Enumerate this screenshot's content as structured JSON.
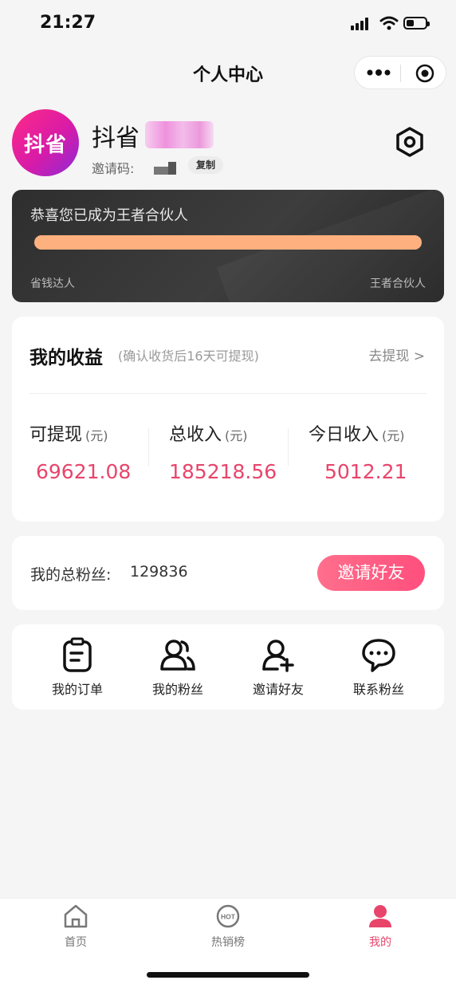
{
  "status_bar": {
    "time": "21:27"
  },
  "nav": {
    "title": "个人中心"
  },
  "profile": {
    "avatar_text": "抖省",
    "name": "抖省",
    "invite_label": "邀请码:",
    "copy_label": "复制"
  },
  "partner_card": {
    "message": "恭喜您已成为王者合伙人",
    "progress": 1.0,
    "level_from": "省钱达人",
    "level_to": "王者合伙人",
    "bar_color": "#ffb07f"
  },
  "income": {
    "title": "我的收益",
    "note": "(确认收货后16天可提现)",
    "withdraw_link": "去提现 >",
    "stats": [
      {
        "label": "可提现",
        "unit": "(元)",
        "value": "69621.08"
      },
      {
        "label": "总收入",
        "unit": "(元)",
        "value": "185218.56"
      },
      {
        "label": "今日收入",
        "unit": "(元)",
        "value": "5012.21"
      }
    ],
    "value_color": "#e8456b"
  },
  "fans": {
    "label": "我的总粉丝:",
    "count": "129836",
    "invite_button": "邀请好友"
  },
  "menu": [
    {
      "label": "我的订单",
      "icon": "order-icon"
    },
    {
      "label": "我的粉丝",
      "icon": "fans-icon"
    },
    {
      "label": "邀请好友",
      "icon": "add-user-icon"
    },
    {
      "label": "联系粉丝",
      "icon": "chat-icon"
    }
  ],
  "tabbar": [
    {
      "label": "首页",
      "icon": "home-icon"
    },
    {
      "label": "热销榜",
      "icon": "hot-icon",
      "icon_text": "HOT"
    },
    {
      "label": "我的",
      "icon": "user-icon",
      "active": true
    }
  ],
  "colors": {
    "accent": "#e8456b",
    "background": "#f5f5f5"
  }
}
